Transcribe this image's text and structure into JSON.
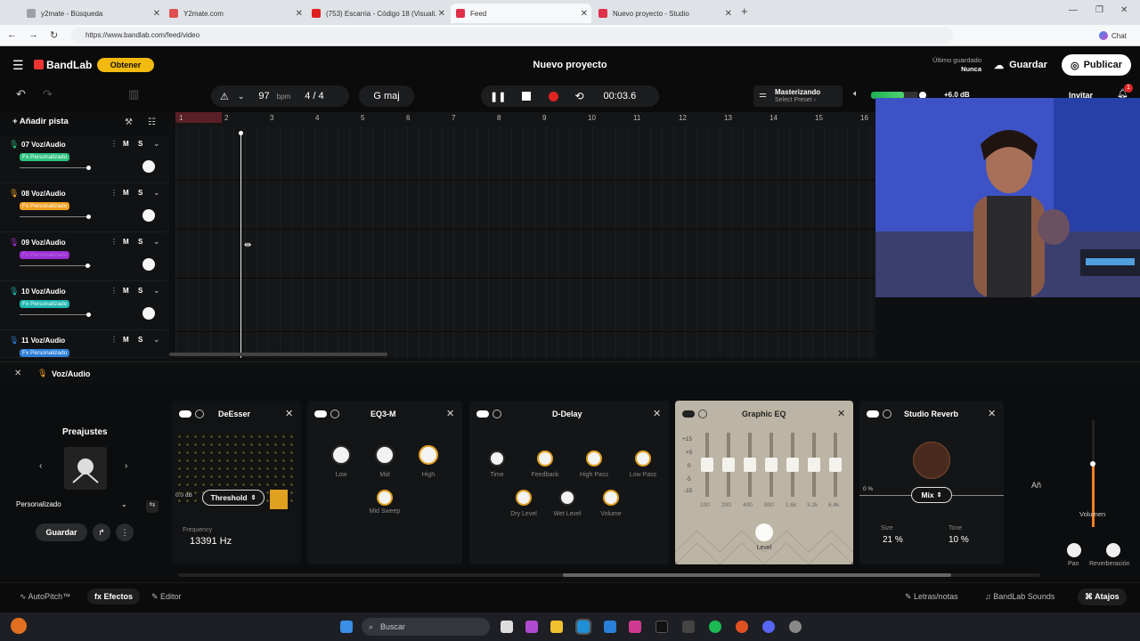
{
  "browser": {
    "tabs": [
      {
        "title": "y2mate - Búsqueda",
        "color": "#9aa0a6"
      },
      {
        "title": "Y2mate.com",
        "color": "#e05050"
      },
      {
        "title": "(753) Escarria - Código 18 (Visuali...",
        "color": "#e02020"
      },
      {
        "title": "Feed",
        "color": "#e0304a"
      },
      {
        "title": "Nuevo proyecto - Studio",
        "color": "#e0304a"
      }
    ],
    "url": "https://www.bandlab.com/feed/video",
    "chat": "Chat"
  },
  "header": {
    "brand": "BandLab",
    "obtener": "Obtener",
    "project_title": "Nuevo proyecto",
    "saved_label": "Último guardado",
    "saved_value": "Nunca",
    "guardar": "Guardar",
    "publicar": "Publicar"
  },
  "toolbar": {
    "bpm_value": "97",
    "bpm_label": "bpm",
    "time_sig": "4 / 4",
    "key": "G maj",
    "time": "00:03.6",
    "master_title": "Masterizando",
    "master_sub": "Select Preset ›",
    "volume_db": "+6.0 dB",
    "invitar": "Invitar",
    "notif_count": "1",
    "master_level": 0.6
  },
  "sidebar": {
    "add_track": "Añadir pista",
    "tracks": [
      {
        "name": "07 Voz/Audio",
        "fx": "Fx Personalizado",
        "fx_color": "#2ec27e",
        "icon_color": "#2ec27e"
      },
      {
        "name": "08 Voz/Audio",
        "fx": "Fx Personalizado",
        "fx_color": "#f0a020",
        "icon_color": "#f0a020"
      },
      {
        "name": "09 Voz/Audio",
        "fx": "Fx Personalizado",
        "fx_color": "#9b30d0",
        "icon_color": "#9b30d0"
      },
      {
        "name": "10 Voz/Audio",
        "fx": "Fx Personalizado",
        "fx_color": "#20b8b0",
        "icon_color": "#20b8b0"
      },
      {
        "name": "11 Voz/Audio",
        "fx": "Fx Personalizado",
        "fx_color": "#2f7fd8",
        "icon_color": "#2f7fd8"
      }
    ],
    "m_label": "M",
    "s_label": "S"
  },
  "ruler": [
    "1",
    "2",
    "3",
    "4",
    "5",
    "6",
    "7",
    "8",
    "9",
    "10",
    "11",
    "12",
    "13",
    "14",
    "15",
    "16"
  ],
  "detail": {
    "track_label": "Voz/Audio"
  },
  "presets": {
    "title": "Preajustes",
    "selected": "Personalizado",
    "save": "Guardar"
  },
  "effects": {
    "deesser": {
      "title": "DeEsser",
      "mode": "Threshold",
      "db": "0.0 dB",
      "freq_label": "Frequency",
      "freq_value": "13391 Hz"
    },
    "eq3m": {
      "title": "EQ3-M",
      "low": "Low",
      "mid": "Mid",
      "high": "High",
      "sweep": "Mid Sweep"
    },
    "ddelay": {
      "title": "D-Delay",
      "time": "Time",
      "feedback": "Feedback",
      "highpass": "High Pass",
      "lowpass": "Low Pass",
      "dry": "Dry Level",
      "wet": "Wet Level",
      "volume": "Volume"
    },
    "geq": {
      "title": "Graphic EQ",
      "scale": [
        "+15",
        "+5",
        "0",
        "-5",
        "-15"
      ],
      "bands": [
        "100",
        "200",
        "400",
        "800",
        "1.6k",
        "3.2k",
        "6.4k"
      ],
      "level": "Level"
    },
    "reverb": {
      "title": "Studio Reverb",
      "pct0": "0 %",
      "mix": "Mix",
      "size_label": "Size",
      "size_value": "21 %",
      "tone_label": "Tone",
      "tone_value": "10 %"
    }
  },
  "mixer": {
    "add": "Añ",
    "volume": "Volumen",
    "pan": "Pan",
    "reverb": "Reverberación"
  },
  "bottom": {
    "autopitch": "AutoPitch™",
    "efectos": "Efectos",
    "editor": "Editor",
    "letras": "Letras/notas",
    "sounds": "BandLab Sounds",
    "atajos": "Atajos"
  },
  "taskbar": {
    "search": "Buscar"
  }
}
